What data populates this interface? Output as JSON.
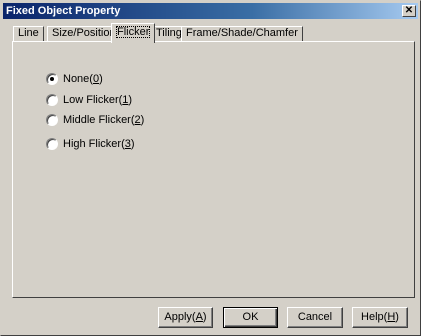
{
  "window": {
    "title": "Fixed Object Property",
    "close_glyph": "✕"
  },
  "tabs": [
    {
      "label": "Line",
      "active": false
    },
    {
      "label": "Size/Position",
      "active": false
    },
    {
      "label": "Flicker",
      "active": true
    },
    {
      "label": "Tiling",
      "active": false
    },
    {
      "label": "Frame/Shade/Chamfer",
      "active": false
    }
  ],
  "flicker_options": [
    {
      "label": "None(",
      "mnemonic": "0",
      "suffix": ")",
      "selected": true
    },
    {
      "label": "Low Flicker(",
      "mnemonic": "1",
      "suffix": ")",
      "selected": false
    },
    {
      "label": "Middle Flicker(",
      "mnemonic": "2",
      "suffix": ")",
      "selected": false
    },
    {
      "label": "High Flicker(",
      "mnemonic": "3",
      "suffix": ")",
      "selected": false
    }
  ],
  "buttons": {
    "apply": {
      "label": "Apply(",
      "mnemonic": "A",
      "suffix": ")"
    },
    "ok": {
      "label": "OK"
    },
    "cancel": {
      "label": "Cancel"
    },
    "help": {
      "label": "Help(",
      "mnemonic": "H",
      "suffix": ")"
    }
  }
}
